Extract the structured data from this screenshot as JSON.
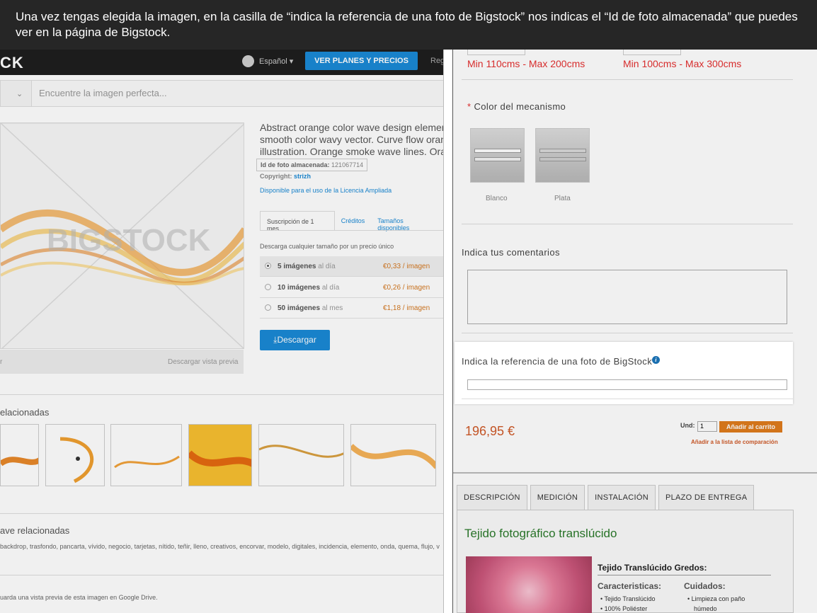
{
  "caption": "Una vez tengas elegida la imagen, en la casilla de “indica la referencia de una foto de Bigstock” nos indicas el “Id de foto almacenada” que puedes ver en la página de Bigstock.",
  "bigstock": {
    "logo": "CK",
    "language": "Español ▾",
    "plans_button": "VER PLANES Y PRECIOS",
    "register": "Reg",
    "search_placeholder": "Encuentre la imagen perfecta...",
    "watermark": "BIGSTOCK",
    "preview_bar_left": "r",
    "preview_bar_right": "Descargar vista previa",
    "description": [
      "Abstract orange color wave design elemen",
      "smooth color wavy vector. Curve flow orang",
      "illustration. Orange smoke wave lines. Oran"
    ],
    "stored_id_label": "Id de foto almacenada:",
    "stored_id": "121067714",
    "copyright_label": "Copyright:",
    "copyright_owner": "strizh",
    "license": "Disponible para el uso de la Licencia Ampliada",
    "tabs": [
      "Suscripción de 1 mes",
      "Créditos",
      "Tamaños disponibles"
    ],
    "plan_intro": "Descarga cualquier tamaño por un precio único",
    "plans": [
      {
        "count": "5 imágenes",
        "period": " al día",
        "price": "€0,33 / imagen",
        "selected": true
      },
      {
        "count": "10 imágenes",
        "period": " al día",
        "price": "€0,26 / imagen",
        "selected": false
      },
      {
        "count": "50 imágenes",
        "period": " al mes",
        "price": "€1,18 / imagen",
        "selected": false
      }
    ],
    "download_button": "Descargar",
    "related_title": "elacionadas",
    "keywords_title": "ave relacionadas",
    "keywords": "backdrop, trasfondo, pancarta, vívido, negocio, tarjetas, nítido, teñir, lleno, creativos, encorvar, modelo, digitales, incidencia, elemento, onda, quema, flujo, v",
    "drive_note": "uarda una vista previa de esta imagen en Google Drive."
  },
  "shop": {
    "size_min_1": "Min 110cms - Max 200cms",
    "size_min_2": "Min 100cms - Max 300cms",
    "mechanism_label": "Color del mecanismo",
    "swatches": [
      "Blanco",
      "Plata"
    ],
    "comments_label": "Indica tus comentarios",
    "reference_label": "Indica la referencia de una foto de BigStock",
    "price": "196,95 €",
    "qty_label": "Und:",
    "qty_value": "1",
    "cart_button": "Añadir al carrito",
    "compare_link": "Añadir a la lista de comparación",
    "tabs": [
      "DESCRIPCIÓN",
      "MEDICIÓN",
      "INSTALACIÓN",
      "PLAZO DE ENTREGA"
    ],
    "product_title": "Tejido fotográfico translúcido",
    "product_subtitle": "Tejido Translúcido Gredos:",
    "col1_title": "Caracteristicas:",
    "col1_items": [
      "Tejido Translúcido",
      "100% Poliéster"
    ],
    "col2_title": "Cuidados:",
    "col2_items": [
      "Limpieza con paño",
      "húmedo"
    ]
  }
}
